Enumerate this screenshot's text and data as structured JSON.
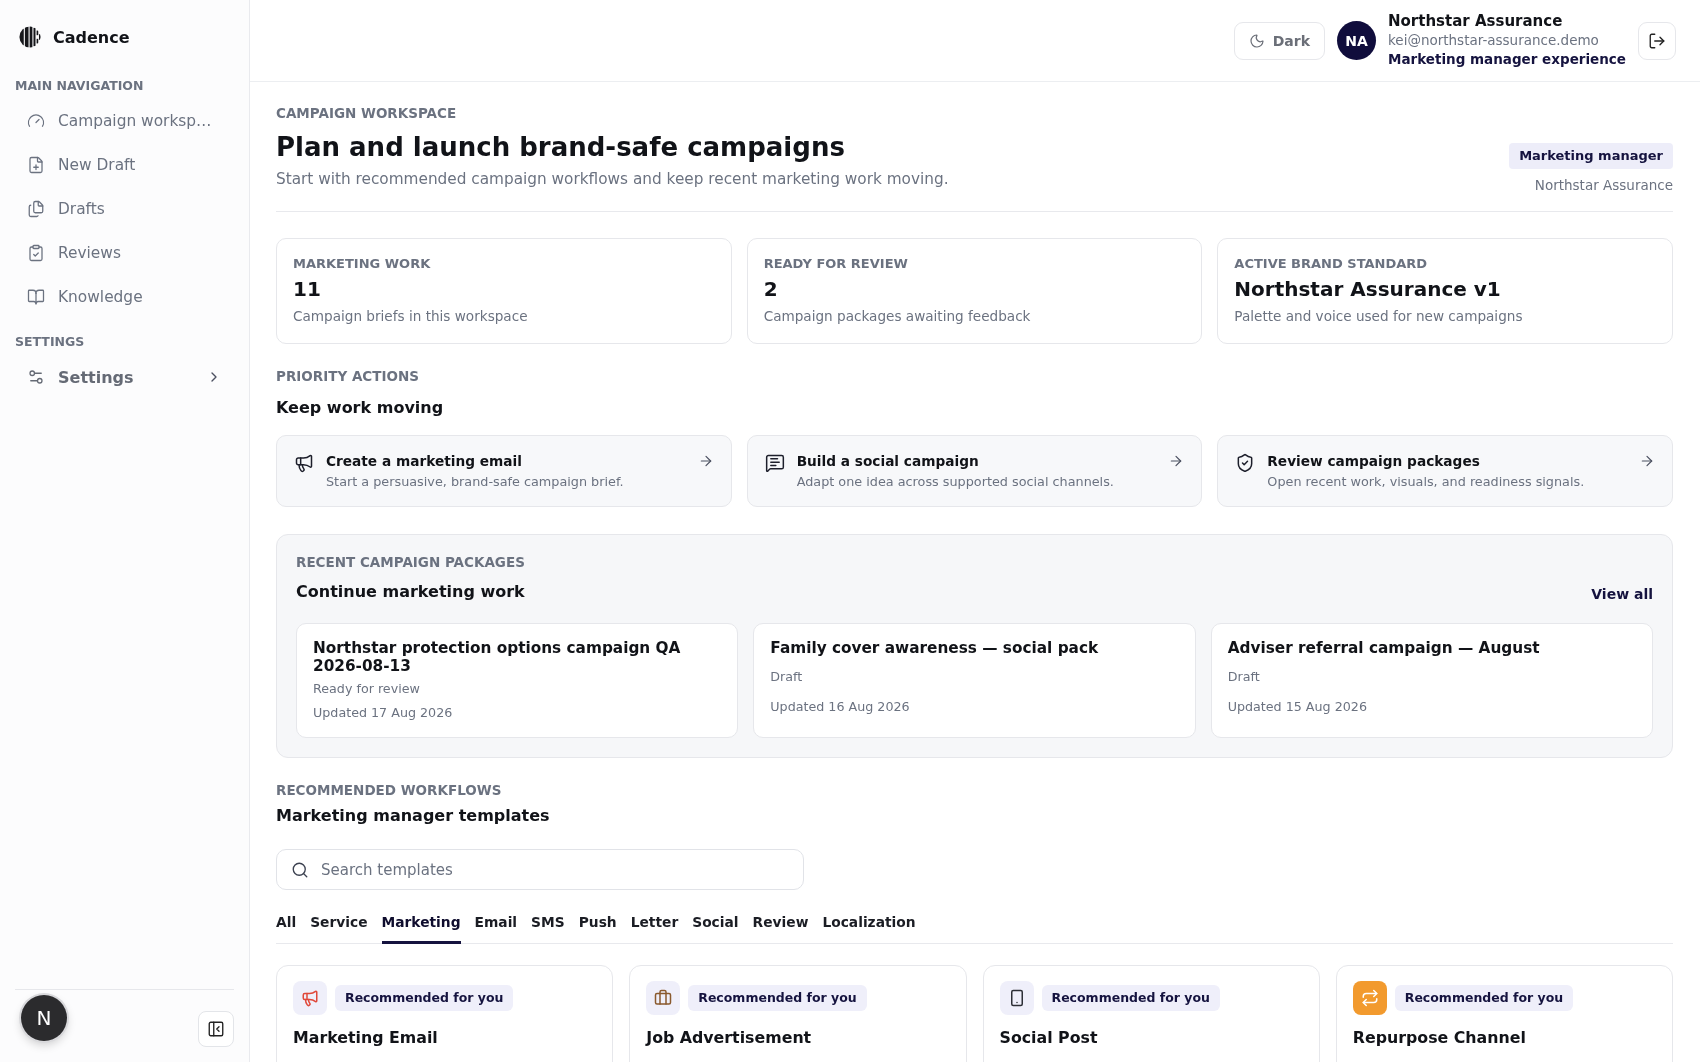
{
  "sidebar": {
    "brand": "Cadence",
    "sections": [
      {
        "label": "MAIN NAVIGATION",
        "items": [
          {
            "label": "Campaign worksp…"
          },
          {
            "label": "New Draft"
          },
          {
            "label": "Drafts"
          },
          {
            "label": "Reviews"
          },
          {
            "label": "Knowledge"
          }
        ]
      },
      {
        "label": "SETTINGS",
        "items": [
          {
            "label": "Settings",
            "expanded": false
          }
        ]
      }
    ],
    "footer_avatar": "N"
  },
  "header": {
    "theme_button": "Dark",
    "user": {
      "initials": "NA",
      "name": "Northstar Assurance",
      "email": "kei@northstar-assurance.demo",
      "experience": "Marketing manager experience"
    }
  },
  "page": {
    "eyebrow": "CAMPAIGN WORKSPACE",
    "title": "Plan and launch brand-safe campaigns",
    "subtitle": "Start with recommended campaign workflows and keep recent marketing work moving.",
    "role_badge": "Marketing manager",
    "organization": "Northstar Assurance"
  },
  "stats": [
    {
      "label": "MARKETING WORK",
      "value": "11",
      "description": "Campaign briefs in this workspace"
    },
    {
      "label": "READY FOR REVIEW",
      "value": "2",
      "description": "Campaign packages awaiting feedback"
    },
    {
      "label": "ACTIVE BRAND STANDARD",
      "value": "Northstar Assurance v1",
      "description": "Palette and voice used for new campaigns"
    }
  ],
  "priority": {
    "eyebrow": "PRIORITY ACTIONS",
    "title": "Keep work moving",
    "actions": [
      {
        "title": "Create a marketing email",
        "description": "Start a persuasive, brand-safe campaign brief."
      },
      {
        "title": "Build a social campaign",
        "description": "Adapt one idea across supported social channels."
      },
      {
        "title": "Review campaign packages",
        "description": "Open recent work, visuals, and readiness signals."
      }
    ]
  },
  "recent": {
    "eyebrow": "RECENT CAMPAIGN PACKAGES",
    "title": "Continue marketing work",
    "link": "View all",
    "packages": [
      {
        "title": "Northstar protection options campaign QA 2026-08-13",
        "status": "Ready for review",
        "updated": "Updated 17 Aug 2026"
      },
      {
        "title": "Family cover awareness — social pack",
        "status": "Draft",
        "updated": "Updated 16 Aug 2026"
      },
      {
        "title": "Adviser referral campaign — August",
        "status": "Draft",
        "updated": "Updated 15 Aug 2026"
      }
    ]
  },
  "workflows": {
    "eyebrow": "RECOMMENDED WORKFLOWS",
    "title": "Marketing manager templates",
    "search": {
      "placeholder": "Search templates"
    },
    "tabs": [
      {
        "label": "All",
        "selected": false
      },
      {
        "label": "Service",
        "selected": false
      },
      {
        "label": "Marketing",
        "selected": true
      },
      {
        "label": "Email",
        "selected": false
      },
      {
        "label": "SMS",
        "selected": false
      },
      {
        "label": "Push",
        "selected": false
      },
      {
        "label": "Letter",
        "selected": false
      },
      {
        "label": "Social",
        "selected": false
      },
      {
        "label": "Review",
        "selected": false
      },
      {
        "label": "Localization",
        "selected": false
      }
    ],
    "templates": [
      {
        "badge": "Recommended for you",
        "title": "Marketing Email"
      },
      {
        "badge": "Recommended for you",
        "title": "Job Advertisement"
      },
      {
        "badge": "Recommended for you",
        "title": "Social Post"
      },
      {
        "badge": "Recommended for you",
        "title": "Repurpose Channel"
      }
    ]
  }
}
